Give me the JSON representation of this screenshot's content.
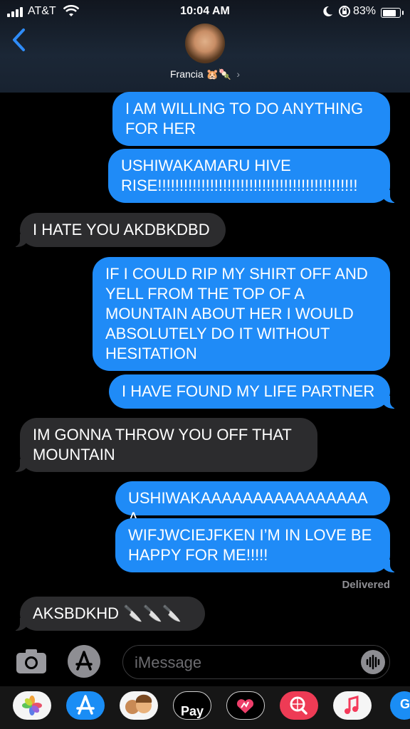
{
  "status_bar": {
    "carrier": "AT&T",
    "time": "10:04 AM",
    "battery": "83%"
  },
  "header": {
    "contact_name": "Francia",
    "contact_emoji": "🐹🍡"
  },
  "messages": [
    {
      "side": "sent",
      "text": "I AM WILLING TO DO ANYTHING FOR HER"
    },
    {
      "side": "sent",
      "text": "USHIWAKAMARU HIVE RISE!!!!!!!!!!!!!!!!!!!!!!!!!!!!!!!!!!!!!!!!!!!!!!"
    },
    {
      "side": "received",
      "text": "I HATE YOU AKDBKDBD"
    },
    {
      "side": "sent",
      "text": "IF I COULD RIP MY SHIRT OFF AND YELL FROM THE TOP OF A MOUNTAIN ABOUT HER I WOULD ABSOLUTELY DO IT WITHOUT HESITATION"
    },
    {
      "side": "sent",
      "text": "I HAVE FOUND MY LIFE PARTNER"
    },
    {
      "side": "received",
      "text": "IM GONNA THROW YOU OFF THAT MOUNTAIN"
    },
    {
      "side": "sent",
      "text": "USHIWAKAAAAAAAAAAAAAAAAA"
    },
    {
      "side": "sent",
      "text": "WIFJWCIEJFKEN I’M IN LOVE BE HAPPY FOR ME!!!!!"
    },
    {
      "side": "received",
      "text": "AKSBDKHD 🔪🔪🔪"
    }
  ],
  "delivered_label": "Delivered",
  "compose": {
    "placeholder": "iMessage"
  },
  "app_drawer": {
    "apps": [
      "photos-icon",
      "app-store-icon",
      "memoji-icon",
      "apple-pay",
      "digital-touch-icon",
      "web-search-icon",
      "music-icon",
      "gif-icon"
    ],
    "apple_pay_label": "Pay",
    "partial_app_label": "G"
  },
  "colors": {
    "sent": "#1f8bf7",
    "received": "#2c2c2e",
    "background": "#000000"
  }
}
